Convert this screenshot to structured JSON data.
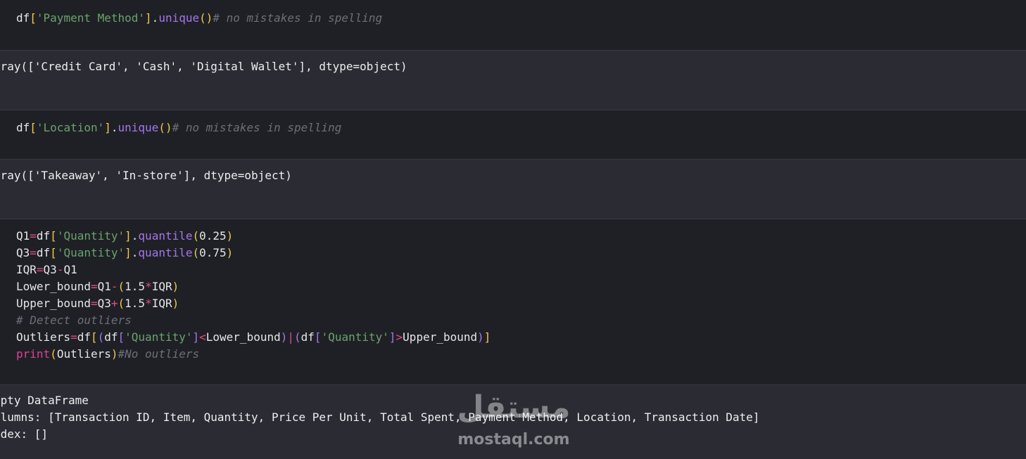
{
  "cells": {
    "c1": {
      "code": [
        "df",
        "[",
        "'Payment Method'",
        "]",
        ".",
        "unique",
        "()",
        "# no mistakes in spelling"
      ],
      "output": "rray(['Credit Card', 'Cash', 'Digital Wallet'], dtype=object)"
    },
    "c2": {
      "code": [
        "df",
        "[",
        "'Location'",
        "]",
        ".",
        "unique",
        "()",
        "# no mistakes in spelling"
      ],
      "output": "rray(['Takeaway', 'In-store'], dtype=object)"
    },
    "c3": {
      "l1": [
        "Q1",
        "=",
        "df",
        "[",
        "'Quantity'",
        "]",
        ".",
        "quantile",
        "(",
        "0.25",
        ")"
      ],
      "l2": [
        "Q3",
        "=",
        "df",
        "[",
        "'Quantity'",
        "]",
        ".",
        "quantile",
        "(",
        "0.75",
        ")"
      ],
      "l3": [
        "IQR",
        "=",
        "Q3",
        "-",
        "Q1"
      ],
      "l4": [
        "Lower_bound",
        "=",
        "Q1",
        "-",
        "(",
        "1.5",
        "*",
        "IQR",
        ")"
      ],
      "l5": [
        "Upper_bound",
        "=",
        "Q3",
        "+",
        "(",
        "1.5",
        "*",
        "IQR",
        ")"
      ],
      "l6": [
        "# Detect outliers"
      ],
      "l7": [
        "Outliers",
        "=",
        "df",
        "[",
        "(",
        "df",
        "[",
        "'Quantity'",
        "]",
        "<",
        "Lower_bound",
        ")",
        "|",
        "(",
        "df",
        "[",
        "'Quantity'",
        "]",
        ">",
        "Upper_bound",
        ")",
        "]"
      ],
      "l8": [
        "print",
        "(",
        "Outliers",
        ")",
        "#No outliers"
      ],
      "output": [
        "mpty DataFrame",
        "olumns: [Transaction ID, Item, Quantity, Price Per Unit, Total Spent, Payment Method, Location, Transaction Date]",
        "ndex: []"
      ]
    }
  },
  "watermark": {
    "arabic": "مستقل",
    "latin": "mostaql.com"
  }
}
